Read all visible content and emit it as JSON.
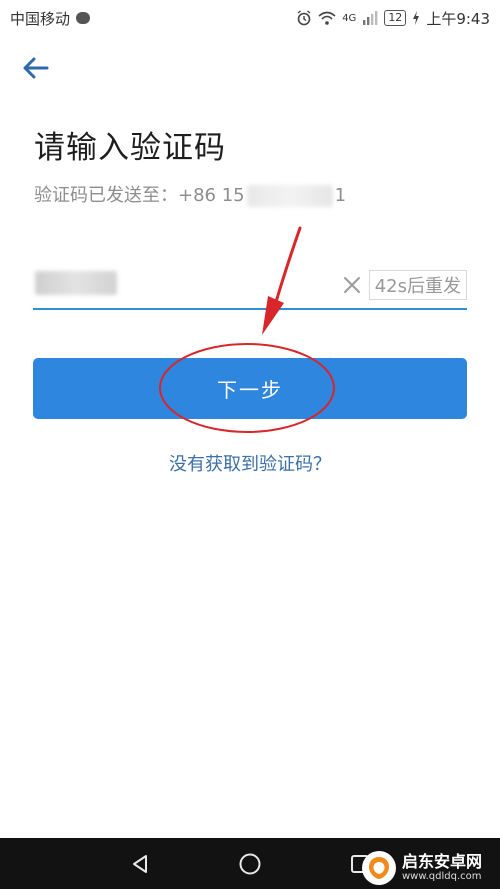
{
  "status_bar": {
    "carrier": "中国移动",
    "network": "4G",
    "battery": "12",
    "time": "上午9:43"
  },
  "page": {
    "title": "请输入验证码",
    "sent_prefix": "验证码已发送至：+86 15",
    "sent_suffix": "1"
  },
  "code_input": {
    "placeholder": "",
    "resend_label": "42s后重发"
  },
  "next_button": {
    "label": "下一步"
  },
  "help_link": {
    "label": "没有获取到验证码？"
  },
  "watermark": {
    "name": "启东安卓网",
    "url": "www.qdldq.com"
  },
  "colors": {
    "primary": "#2f86de",
    "underline": "#2d8fcf",
    "link": "#3b6fa8",
    "annotation": "#d8262a",
    "watermark_accent": "#f08a1c"
  }
}
